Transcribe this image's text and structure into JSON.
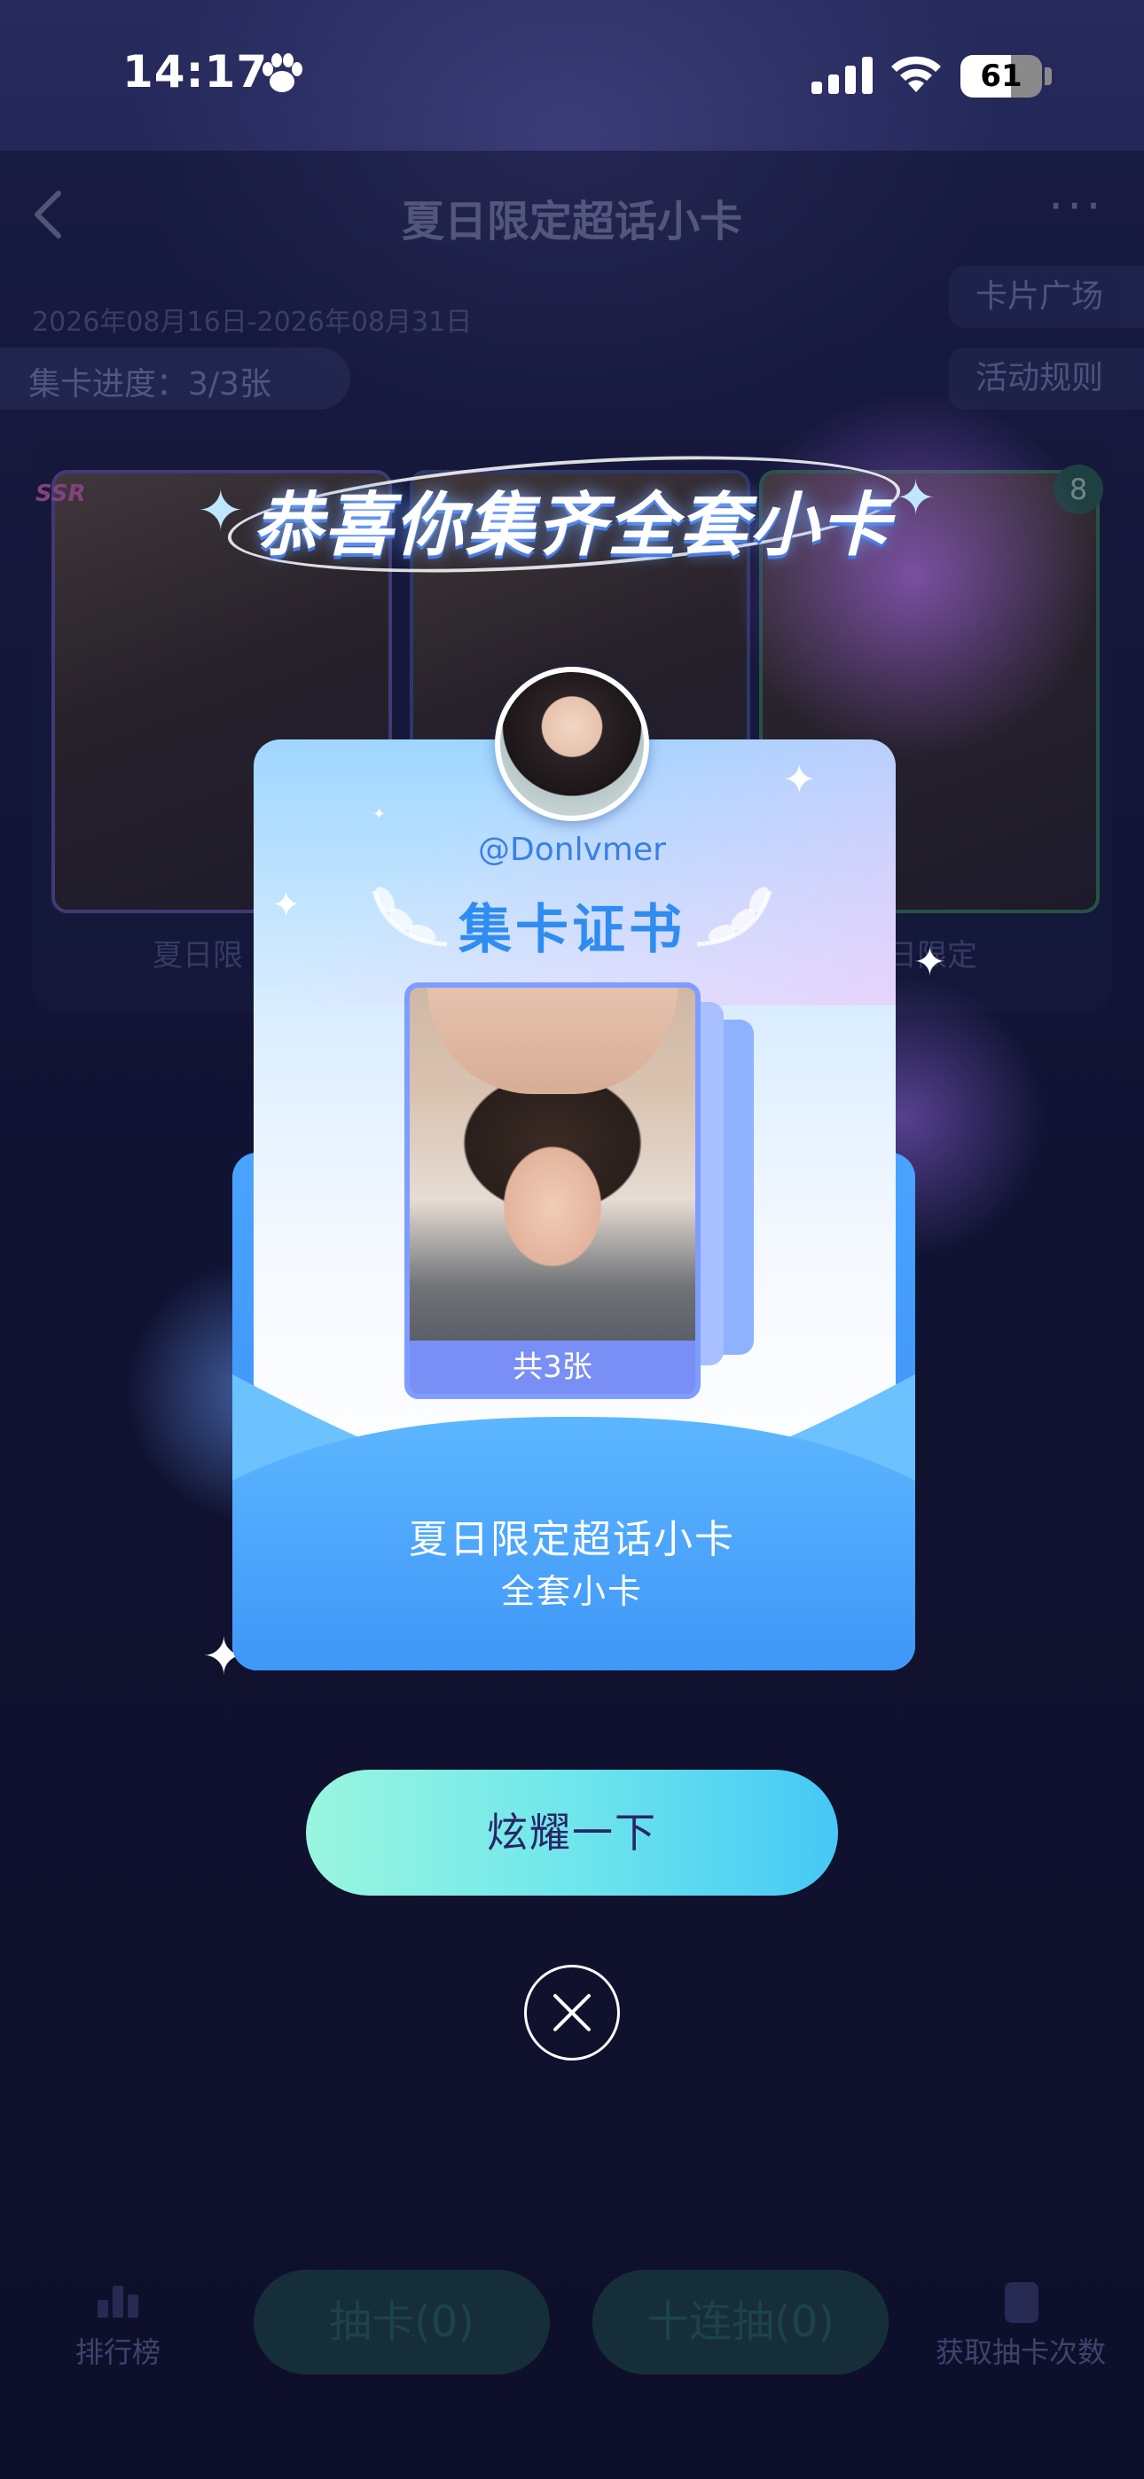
{
  "status_bar": {
    "time": "14:17",
    "battery": "61"
  },
  "nav": {
    "title": "夏日限定超话小卡",
    "back_icon": "chevron-left-icon",
    "more_icon": "more-horizontal-icon"
  },
  "event": {
    "date_range": "2026年08月16日-2026年08月31日",
    "progress_label": "集卡进度：3/3张",
    "card_plaza": "卡片广场",
    "rules": "活动规则"
  },
  "background_cards": {
    "rarity_badge": "SSR",
    "count_badge": "8",
    "caption_left": "夏日限",
    "caption_right": "日限定"
  },
  "bottom_bar": {
    "rank_label": "排行榜",
    "draw_label": "抽卡(0)",
    "ten_draw_label": "十连抽(0)",
    "get_draws_label": "获取抽卡次数"
  },
  "modal": {
    "headline": "恭喜你集齐全套小卡",
    "username": "@Donlvmer",
    "certificate_title": "集卡证书",
    "card_count_label": "共3张",
    "series_name": "夏日限定超话小卡",
    "series_subtitle": "全套小卡",
    "share_button": "炫耀一下",
    "close_icon": "close-icon"
  },
  "colors": {
    "background": "#141638",
    "accent_blue": "#3a8ef5",
    "cta_start": "#9af6de",
    "cta_end": "#45c8f5",
    "cta_text": "#2a2566"
  }
}
